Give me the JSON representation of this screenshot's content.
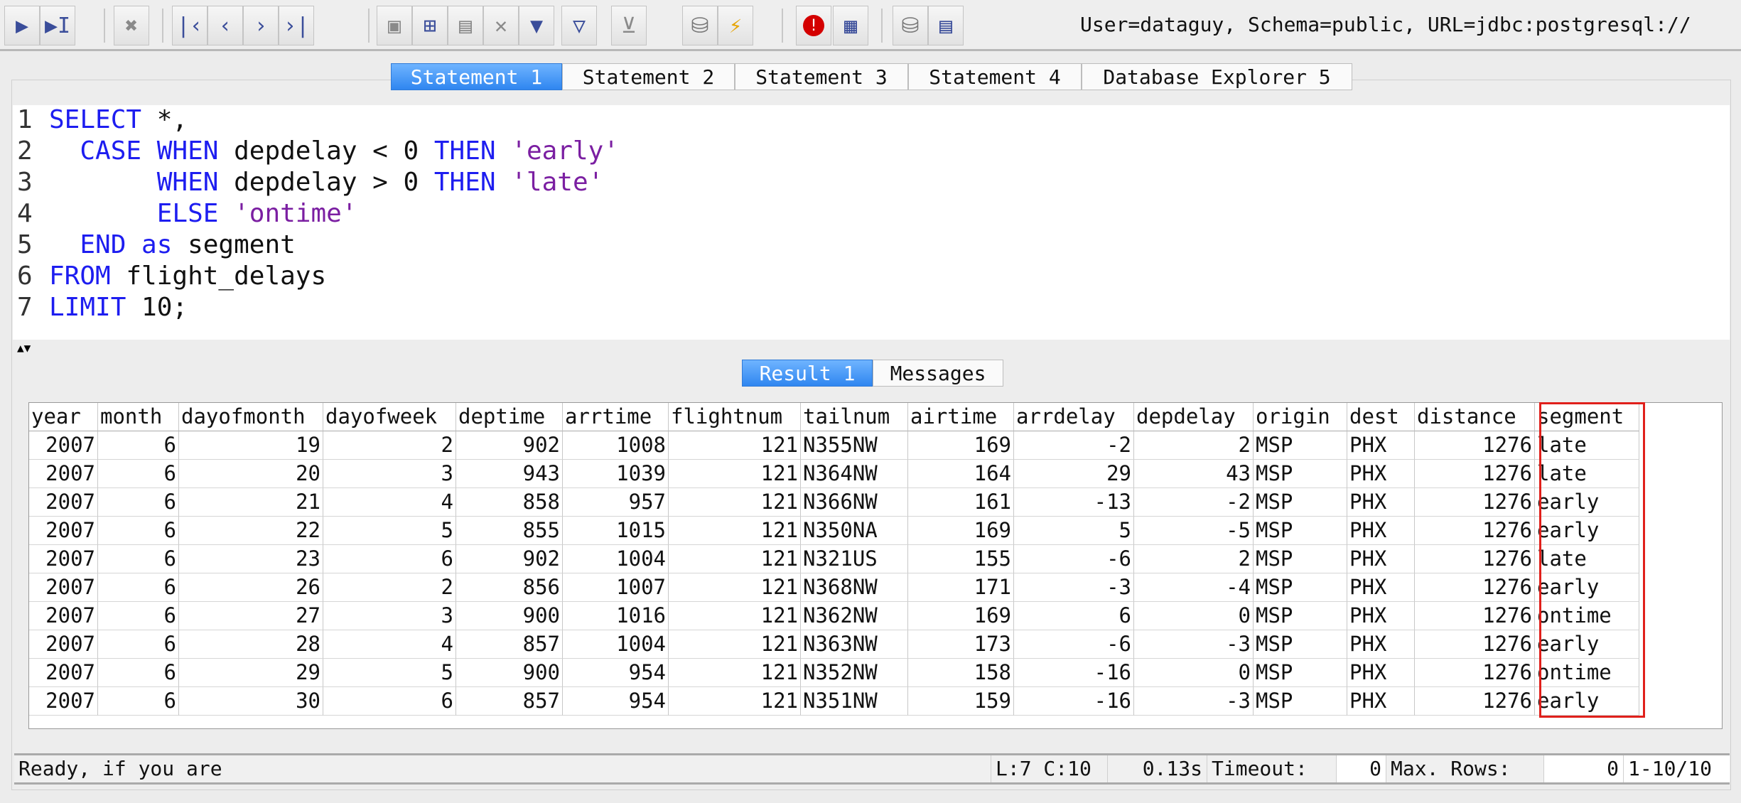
{
  "toolbar": {
    "buttons": [
      {
        "name": "execute-icon",
        "glyph": "▶"
      },
      {
        "name": "execute-current-icon",
        "glyph": "▶I"
      },
      {
        "name": "cancel-icon",
        "glyph": "✖"
      },
      {
        "name": "first-icon",
        "glyph": "|‹"
      },
      {
        "name": "previous-icon",
        "glyph": "‹"
      },
      {
        "name": "next-icon",
        "glyph": "›"
      },
      {
        "name": "last-icon",
        "glyph": "›|"
      },
      {
        "name": "save-icon",
        "glyph": "▣"
      },
      {
        "name": "insert-row-icon",
        "glyph": "⊞"
      },
      {
        "name": "copy-row-icon",
        "glyph": "▤"
      },
      {
        "name": "delete-row-icon",
        "glyph": "✕"
      },
      {
        "name": "filter-columns-icon",
        "glyph": "▼"
      },
      {
        "name": "filter-icon",
        "glyph": "▽"
      },
      {
        "name": "clear-filter-icon",
        "glyph": "⊻"
      },
      {
        "name": "commit-icon",
        "glyph": "⛁"
      },
      {
        "name": "rollback-icon",
        "glyph": "⚡"
      },
      {
        "name": "autocommit-icon",
        "glyph": "!"
      },
      {
        "name": "grid-icon",
        "glyph": "▦"
      },
      {
        "name": "database-icon",
        "glyph": "⛁"
      },
      {
        "name": "explorer-icon",
        "glyph": "▤"
      }
    ],
    "connection": "User=dataguy, Schema=public, URL=jdbc:postgresql://"
  },
  "tabs": [
    "Statement 1",
    "Statement 2",
    "Statement 3",
    "Statement 4",
    "Database Explorer 5"
  ],
  "editor": {
    "line_numbers": [
      "1",
      "2",
      "3",
      "4",
      "5",
      "6",
      "7"
    ]
  },
  "result_tabs": [
    "Result 1",
    "Messages"
  ],
  "grid": {
    "columns": [
      "year",
      "month",
      "dayofmonth",
      "dayofweek",
      "deptime",
      "arrtime",
      "flightnum",
      "tailnum",
      "airtime",
      "arrdelay",
      "depdelay",
      "origin",
      "dest",
      "distance",
      "segment"
    ],
    "rows": [
      [
        "2007",
        "6",
        "19",
        "2",
        "902",
        "1008",
        "121",
        "N355NW",
        "169",
        "-2",
        "2",
        "MSP",
        "PHX",
        "1276",
        "late"
      ],
      [
        "2007",
        "6",
        "20",
        "3",
        "943",
        "1039",
        "121",
        "N364NW",
        "164",
        "29",
        "43",
        "MSP",
        "PHX",
        "1276",
        "late"
      ],
      [
        "2007",
        "6",
        "21",
        "4",
        "858",
        "957",
        "121",
        "N366NW",
        "161",
        "-13",
        "-2",
        "MSP",
        "PHX",
        "1276",
        "early"
      ],
      [
        "2007",
        "6",
        "22",
        "5",
        "855",
        "1015",
        "121",
        "N350NA",
        "169",
        "5",
        "-5",
        "MSP",
        "PHX",
        "1276",
        "early"
      ],
      [
        "2007",
        "6",
        "23",
        "6",
        "902",
        "1004",
        "121",
        "N321US",
        "155",
        "-6",
        "2",
        "MSP",
        "PHX",
        "1276",
        "late"
      ],
      [
        "2007",
        "6",
        "26",
        "2",
        "856",
        "1007",
        "121",
        "N368NW",
        "171",
        "-3",
        "-4",
        "MSP",
        "PHX",
        "1276",
        "early"
      ],
      [
        "2007",
        "6",
        "27",
        "3",
        "900",
        "1016",
        "121",
        "N362NW",
        "169",
        "6",
        "0",
        "MSP",
        "PHX",
        "1276",
        "ontime"
      ],
      [
        "2007",
        "6",
        "28",
        "4",
        "857",
        "1004",
        "121",
        "N363NW",
        "173",
        "-6",
        "-3",
        "MSP",
        "PHX",
        "1276",
        "early"
      ],
      [
        "2007",
        "6",
        "29",
        "5",
        "900",
        "954",
        "121",
        "N352NW",
        "158",
        "-16",
        "0",
        "MSP",
        "PHX",
        "1276",
        "ontime"
      ],
      [
        "2007",
        "6",
        "30",
        "6",
        "857",
        "954",
        "121",
        "N351NW",
        "159",
        "-16",
        "-3",
        "MSP",
        "PHX",
        "1276",
        "early"
      ]
    ]
  },
  "status": {
    "message": "Ready, if you are",
    "position": "L:7 C:10",
    "time": "0.13s",
    "timeout_label": "Timeout:",
    "timeout_value": "0",
    "maxrows_label": "Max. Rows:",
    "maxrows_value": "0",
    "range": "1-10/10"
  },
  "colors": {
    "keyword": "#1d1df0",
    "string": "#7b1fa2",
    "active_tab": "#2f86f0",
    "highlight_border": "#e0201b"
  }
}
